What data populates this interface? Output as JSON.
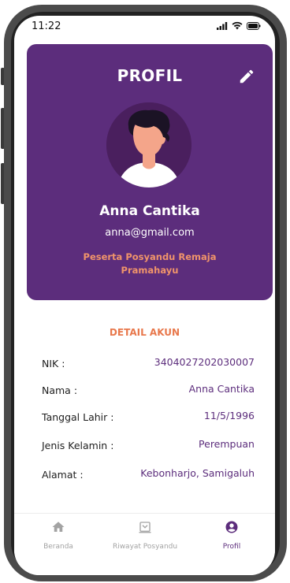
{
  "status_bar": {
    "time": "11:22"
  },
  "profile_card": {
    "title": "PROFIL",
    "name": "Anna Cantika",
    "email": "anna@gmail.com",
    "role": "Peserta Posyandu Remaja Pramahayu"
  },
  "detail": {
    "title": "DETAIL AKUN",
    "rows": [
      {
        "label": "NIK :",
        "value": "3404027202030007"
      },
      {
        "label": "Nama :",
        "value": "Anna Cantika"
      },
      {
        "label": "Tanggal Lahir :",
        "value": "11/5/1996"
      },
      {
        "label": "Jenis Kelamin :",
        "value": "Perempuan"
      },
      {
        "label": "Alamat :",
        "value": "Kebonharjo, Samigaluh"
      }
    ]
  },
  "bottom_nav": {
    "items": [
      {
        "label": "Beranda",
        "icon": "home-icon",
        "active": false
      },
      {
        "label": "Riwayat Posyandu",
        "icon": "history-icon",
        "active": false
      },
      {
        "label": "Profil",
        "icon": "account-circle-icon",
        "active": true
      }
    ]
  },
  "colors": {
    "primary": "#5c2d7c",
    "accent": "#e8784c",
    "inactive": "#a3a3a3"
  }
}
